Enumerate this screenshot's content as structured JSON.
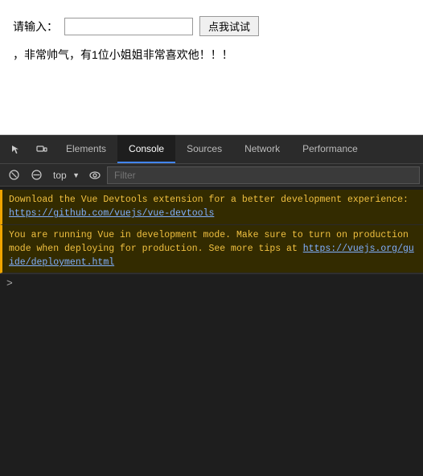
{
  "page": {
    "input_label": "请输入：",
    "input_placeholder": "",
    "button_label": "点我试试",
    "description": "，非常帅气，有1位小姐姐非常喜欢他！！！"
  },
  "devtools": {
    "tabs": [
      {
        "label": "Elements",
        "active": false
      },
      {
        "label": "Console",
        "active": true
      },
      {
        "label": "Sources",
        "active": false
      },
      {
        "label": "Network",
        "active": false
      },
      {
        "label": "Performance",
        "active": false
      }
    ],
    "console": {
      "context": "top",
      "filter_placeholder": "Filter",
      "messages": [
        {
          "type": "warn",
          "text": "Download the Vue Devtools extension for a better development experience:",
          "link": "https://github.com/vuejs/vue-devtools",
          "link_text": "https://github.com/vuejs/vue-devtools"
        },
        {
          "type": "warn",
          "text": "You are running Vue in development mode.\nMake sure to turn on production mode when deploying for production.\nSee more tips at ",
          "link": "https://vuejs.org/guide/deployment.html",
          "link_text": "https://vuejs.org/guide/deployment.html"
        }
      ],
      "prompt": ">"
    }
  }
}
